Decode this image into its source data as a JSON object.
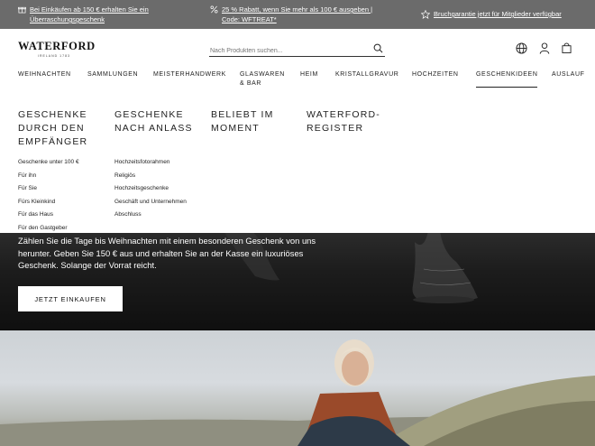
{
  "promo": {
    "item1": "Bei Einkäufen ab 150 € erhalten Sie ein Überraschungsgeschenk",
    "item2": "25 % Rabatt, wenn Sie mehr als 100 € ausgeben | Code: WFTREAT*",
    "item3": "Bruchgarantie jetzt für Mitglieder verfügbar"
  },
  "header": {
    "logo_text": "WATERFORD",
    "logo_subtext": "IRELAND 1783",
    "search_placeholder": "Nach Produkten suchen..."
  },
  "nav": {
    "items": [
      "WEIHNACHTEN",
      "SAMMLUNGEN",
      "MEISTERHANDWERK",
      "GLASWAREN & BAR",
      "HEIM",
      "KRISTALLGRAVUR",
      "HOCHZEITEN",
      "GESCHENKIDEEN",
      "AUSLAUF"
    ],
    "active": "GESCHENKIDEEN"
  },
  "mega": {
    "col1": {
      "title": "GESCHENKE DURCH DEN EMPFÄNGER",
      "links": [
        "Geschenke unter 100 €",
        "Für ihn",
        "Für Sie",
        "Fürs Kleinkind",
        "Für das Haus",
        "Für den Gastgeber"
      ]
    },
    "col2": {
      "title": "GESCHENKE NACH ANLASS",
      "links": [
        "Hochzeitsfotorahmen",
        "Religiös",
        "Hochzeitsgeschenke",
        "Geschäft und Unternehmen",
        "Abschluss"
      ]
    },
    "col3": {
      "title": "BELIEBT IM MOMENT"
    },
    "col4": {
      "title": "WATERFORD-REGISTER"
    }
  },
  "hero": {
    "text": "Zählen Sie die Tage bis Weihnachten mit einem besonderen Geschenk von uns herunter. Geben Sie 150 € aus und erhalten Sie an der Kasse ein luxuriöses Geschenk. Solange der Vorrat reicht.",
    "button": "JETZT EINKAUFEN"
  },
  "colors": {
    "promo_bg": "#6b6b6b",
    "hero_bg": "#1c1c1c",
    "text": "#222222"
  },
  "icons": [
    "gift-icon",
    "percent-icon",
    "star-icon",
    "search-icon",
    "globe-icon",
    "user-icon",
    "bag-icon"
  ]
}
